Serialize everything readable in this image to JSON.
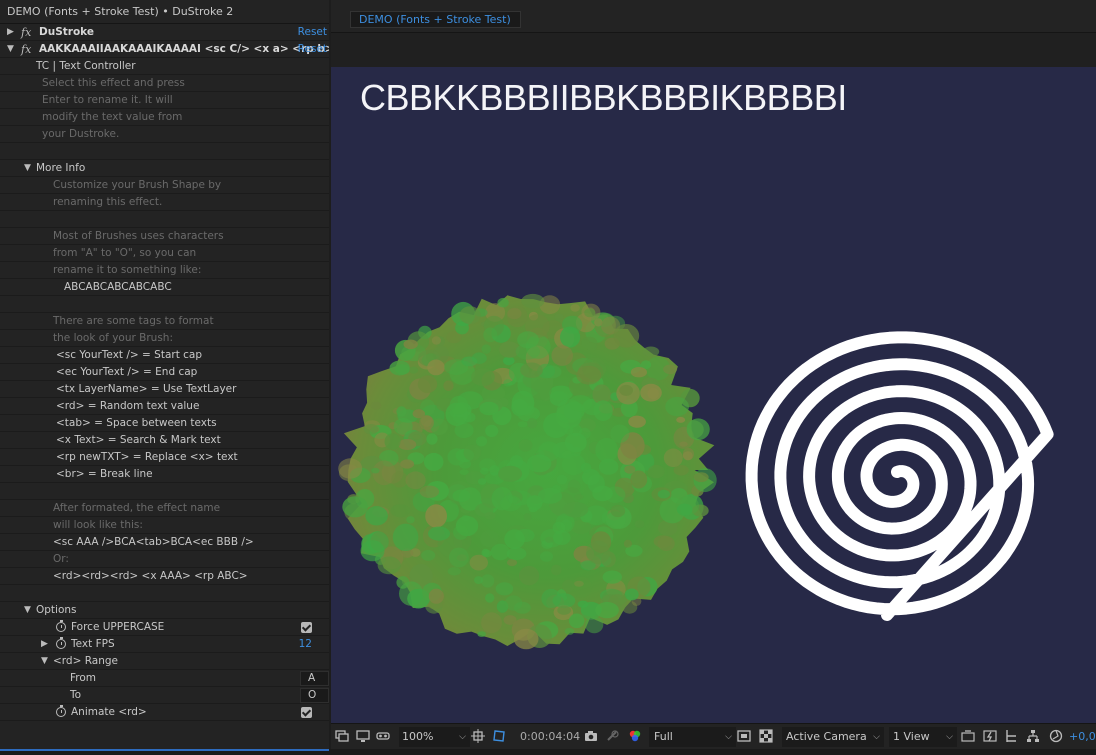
{
  "panel_title": "DEMO (Fonts + Stroke Test) • DuStroke 2",
  "effects": [
    {
      "name": "DuStroke",
      "reset": "Reset"
    },
    {
      "name": "AAKKAAAIIAAKAAAIKAAAAI <sc C/> <x a> <rp b>",
      "reset": "Reset"
    }
  ],
  "text_controller": "TC | Text Controller",
  "rename_help": [
    "Select this effect and press",
    "Enter to rename it. It will",
    "modify the text value from",
    "your Dustroke."
  ],
  "more_info": {
    "label": "More Info",
    "lines": [
      {
        "text": "Customize your Brush Shape by",
        "dim": true
      },
      {
        "text": "renaming this effect.",
        "dim": true
      },
      {
        "text": "",
        "dim": true
      },
      {
        "text": "Most of Brushes uses characters",
        "dim": true
      },
      {
        "text": "from \"A\" to \"O\", so you can",
        "dim": true
      },
      {
        "text": "rename it to something like:",
        "dim": true
      },
      {
        "text": "ABCABCABCABCABC",
        "dim": false,
        "indent": 64
      },
      {
        "text": "",
        "dim": true
      },
      {
        "text": "There are some tags to format",
        "dim": true
      },
      {
        "text": "the look of your Brush:",
        "dim": true
      },
      {
        "text": "<sc YourText /> = Start cap",
        "dim": false,
        "indent": 56
      },
      {
        "text": "<ec YourText /> = End cap",
        "dim": false,
        "indent": 56
      },
      {
        "text": "<tx LayerName> = Use TextLayer",
        "dim": false,
        "indent": 56
      },
      {
        "text": "<rd> = Random text value",
        "dim": false,
        "indent": 56
      },
      {
        "text": "<tab> = Space between texts",
        "dim": false,
        "indent": 56
      },
      {
        "text": "<x Text> = Search & Mark text",
        "dim": false,
        "indent": 56
      },
      {
        "text": "<rp newTXT> = Replace <x> text",
        "dim": false,
        "indent": 56
      },
      {
        "text": "<br> = Break line",
        "dim": false,
        "indent": 56
      },
      {
        "text": "",
        "dim": true
      },
      {
        "text": "After formated, the effect name",
        "dim": true
      },
      {
        "text": "will look like this:",
        "dim": true
      },
      {
        "text": "<sc AAA />BCA<tab>BCA<ec BBB />",
        "dim": false
      },
      {
        "text": "Or:",
        "dim": true
      },
      {
        "text": "<rd><rd><rd> <x AAA> <rp ABC>",
        "dim": false
      }
    ]
  },
  "options": {
    "label": "Options",
    "force_uppercase": "Force UPPERCASE",
    "text_fps": "Text FPS",
    "text_fps_value": "12",
    "rd_range": "<rd> Range",
    "from_label": "From",
    "from_value": "A",
    "to_label": "To",
    "to_value": "O",
    "animate_rd": "Animate <rd>"
  },
  "comp_tab": "DEMO (Fonts + Stroke Test)",
  "canvas_text": "CBBKKBBBIIBBKBBBIKBBBBI",
  "colors": {
    "canvas_bg": "#272947",
    "accent": "#3d8fe0",
    "bush_green": "#4fa544",
    "spiral": "#ffffff"
  },
  "toolbar": {
    "zoom": "100%",
    "timecode": "0:00:04:04",
    "resolution": "Full",
    "camera": "Active Camera",
    "views": "1 View",
    "exposure": "+0,0"
  }
}
